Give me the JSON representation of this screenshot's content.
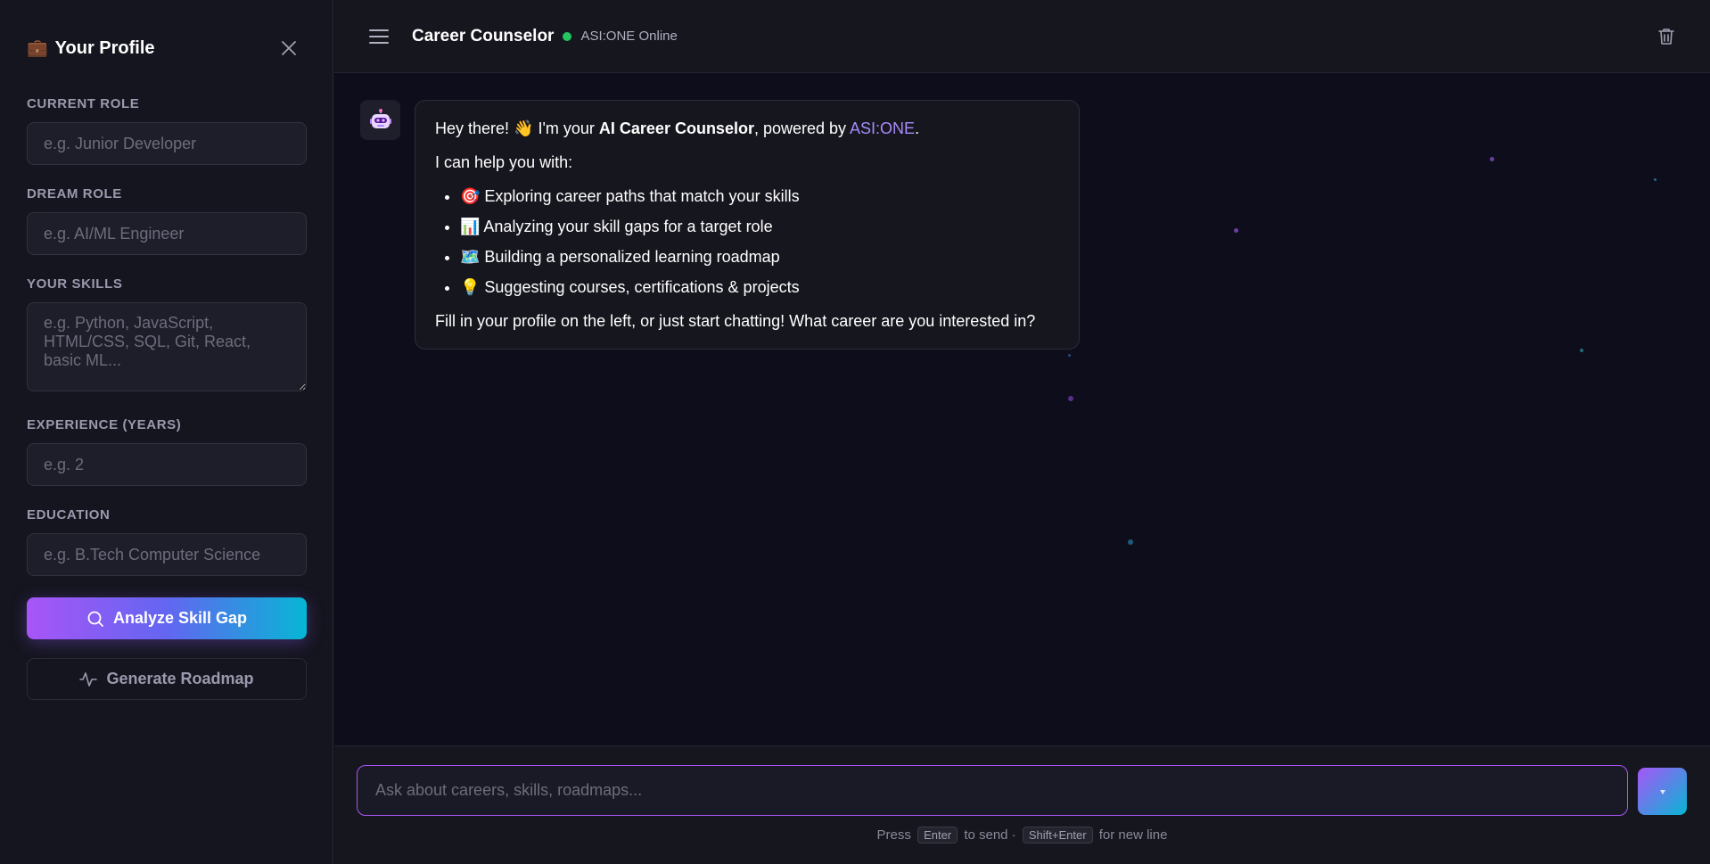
{
  "colors": {
    "accent": "#a855f7",
    "accent_end": "#06b6d4",
    "online": "#22c55e"
  },
  "sidebar": {
    "title": "Your Profile",
    "title_icon": "briefcase-icon",
    "fields": {
      "current_role": {
        "label": "Current Role",
        "placeholder": "e.g. Junior Developer",
        "value": ""
      },
      "dream_role": {
        "label": "Dream Role",
        "placeholder": "e.g. AI/ML Engineer",
        "value": ""
      },
      "skills": {
        "label": "Your Skills",
        "placeholder": "e.g. Python, JavaScript, HTML/CSS, SQL, Git, React, basic ML...",
        "value": ""
      },
      "experience": {
        "label": "Experience (Years)",
        "placeholder": "e.g. 2",
        "value": ""
      },
      "education": {
        "label": "Education",
        "placeholder": "e.g. B.Tech Computer Science",
        "value": ""
      }
    },
    "analyze_button": "Analyze Skill Gap",
    "roadmap_button": "Generate Roadmap"
  },
  "header": {
    "title": "Career Counselor",
    "status": "ASI:ONE Online"
  },
  "message": {
    "greeting_start": "Hey there! 👋 I'm your ",
    "greeting_bold": "AI Career Counselor",
    "greeting_mid": ", powered by ",
    "greeting_link": "ASI:ONE",
    "greeting_end": ".",
    "intro": "I can help you with:",
    "items": [
      "🎯 Exploring career paths that match your skills",
      "📊 Analyzing your skill gaps for a target role",
      "🗺️ Building a personalized learning roadmap",
      "💡 Suggesting courses, certifications & projects"
    ],
    "closing": "Fill in your profile on the left, or just start chatting! What career are you interested in?"
  },
  "composer": {
    "placeholder": "Ask about careers, skills, roadmaps...",
    "value": "",
    "hint_press": "Press",
    "hint_enter": "Enter",
    "hint_send": "to send ·",
    "hint_shift": "Shift+Enter",
    "hint_newline": "for new line"
  }
}
